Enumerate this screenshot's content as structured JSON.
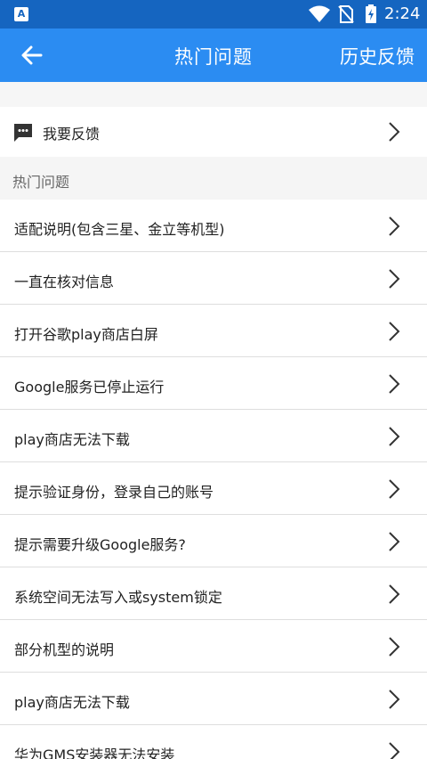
{
  "status_bar": {
    "time": "2:24",
    "app_icon_letter": "A",
    "icons": [
      "wifi-icon",
      "no-sim-icon",
      "battery-icon"
    ]
  },
  "app_bar": {
    "title": "热门问题",
    "history_label": "历史反馈",
    "back_icon": "back-arrow-icon"
  },
  "feedback": {
    "label": "我要反馈",
    "icon": "message-icon"
  },
  "section": {
    "title": "热门问题"
  },
  "questions": [
    {
      "label": "适配说明(包含三星、金立等机型)"
    },
    {
      "label": "一直在核对信息"
    },
    {
      "label": "打开谷歌play商店白屏"
    },
    {
      "label": "Google服务已停止运行"
    },
    {
      "label": "play商店无法下载"
    },
    {
      "label": "提示验证身份，登录自己的账号"
    },
    {
      "label": "提示需要升级Google服务?"
    },
    {
      "label": "系统空间无法写入或system锁定"
    },
    {
      "label": "部分机型的说明"
    },
    {
      "label": "play商店无法下载"
    },
    {
      "label": "华为GMS安装器无法安装"
    }
  ],
  "colors": {
    "status_bar": "#1565c0",
    "app_bar": "#2b8cf2",
    "background": "#f6f6f6"
  }
}
